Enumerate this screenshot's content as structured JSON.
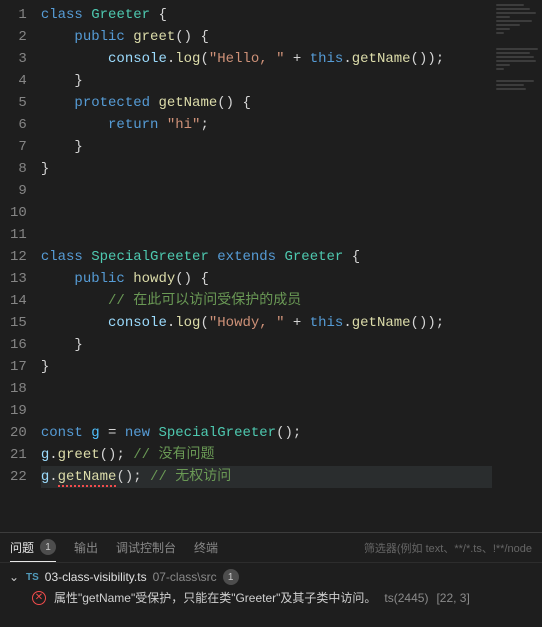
{
  "chart_data": null,
  "editor": {
    "lines": [
      {
        "n": 1,
        "seg": [
          [
            "tk-kw",
            "class "
          ],
          [
            "tk-cls",
            "Greeter"
          ],
          [
            "tk-pun",
            " {"
          ]
        ]
      },
      {
        "n": 2,
        "seg": [
          [
            "tk-pun",
            "    "
          ],
          [
            "tk-kw",
            "public "
          ],
          [
            "tk-fn",
            "greet"
          ],
          [
            "tk-pun",
            "() {"
          ]
        ]
      },
      {
        "n": 3,
        "seg": [
          [
            "tk-pun",
            "        "
          ],
          [
            "tk-var",
            "console"
          ],
          [
            "tk-pun",
            "."
          ],
          [
            "tk-fn",
            "log"
          ],
          [
            "tk-pun",
            "("
          ],
          [
            "tk-str",
            "\"Hello, \""
          ],
          [
            "tk-pun",
            " + "
          ],
          [
            "tk-kw",
            "this"
          ],
          [
            "tk-pun",
            "."
          ],
          [
            "tk-fn",
            "getName"
          ],
          [
            "tk-pun",
            "());"
          ]
        ]
      },
      {
        "n": 4,
        "seg": [
          [
            "tk-pun",
            "    }"
          ]
        ]
      },
      {
        "n": 5,
        "seg": [
          [
            "tk-pun",
            "    "
          ],
          [
            "tk-kw",
            "protected "
          ],
          [
            "tk-fn",
            "getName"
          ],
          [
            "tk-pun",
            "() {"
          ]
        ]
      },
      {
        "n": 6,
        "seg": [
          [
            "tk-pun",
            "        "
          ],
          [
            "tk-kw",
            "return "
          ],
          [
            "tk-str",
            "\"hi\""
          ],
          [
            "tk-pun",
            ";"
          ]
        ]
      },
      {
        "n": 7,
        "seg": [
          [
            "tk-pun",
            "    }"
          ]
        ]
      },
      {
        "n": 8,
        "seg": [
          [
            "tk-pun",
            "}"
          ]
        ]
      },
      {
        "n": 9,
        "seg": [
          [
            "tk-pun",
            ""
          ]
        ]
      },
      {
        "n": 10,
        "seg": [
          [
            "tk-pun",
            ""
          ]
        ]
      },
      {
        "n": 11,
        "seg": [
          [
            "tk-pun",
            ""
          ]
        ]
      },
      {
        "n": 12,
        "seg": [
          [
            "tk-kw",
            "class "
          ],
          [
            "tk-cls",
            "SpecialGreeter"
          ],
          [
            "tk-kw",
            " extends "
          ],
          [
            "tk-cls",
            "Greeter"
          ],
          [
            "tk-pun",
            " {"
          ]
        ]
      },
      {
        "n": 13,
        "seg": [
          [
            "tk-pun",
            "    "
          ],
          [
            "tk-kw",
            "public "
          ],
          [
            "tk-fn",
            "howdy"
          ],
          [
            "tk-pun",
            "() {"
          ]
        ]
      },
      {
        "n": 14,
        "seg": [
          [
            "tk-pun",
            "        "
          ],
          [
            "tk-com",
            "// 在此可以访问受保护的成员"
          ]
        ]
      },
      {
        "n": 15,
        "seg": [
          [
            "tk-pun",
            "        "
          ],
          [
            "tk-var",
            "console"
          ],
          [
            "tk-pun",
            "."
          ],
          [
            "tk-fn",
            "log"
          ],
          [
            "tk-pun",
            "("
          ],
          [
            "tk-str",
            "\"Howdy, \""
          ],
          [
            "tk-pun",
            " + "
          ],
          [
            "tk-kw",
            "this"
          ],
          [
            "tk-pun",
            "."
          ],
          [
            "tk-fn",
            "getName"
          ],
          [
            "tk-pun",
            "());"
          ]
        ]
      },
      {
        "n": 16,
        "seg": [
          [
            "tk-pun",
            "    }"
          ]
        ]
      },
      {
        "n": 17,
        "seg": [
          [
            "tk-pun",
            "}"
          ]
        ]
      },
      {
        "n": 18,
        "seg": [
          [
            "tk-pun",
            ""
          ]
        ]
      },
      {
        "n": 19,
        "seg": [
          [
            "tk-pun",
            ""
          ]
        ]
      },
      {
        "n": 20,
        "seg": [
          [
            "tk-kw",
            "const "
          ],
          [
            "tk-obj",
            "g"
          ],
          [
            "tk-pun",
            " = "
          ],
          [
            "tk-kw",
            "new "
          ],
          [
            "tk-cls",
            "SpecialGreeter"
          ],
          [
            "tk-pun",
            "();"
          ]
        ]
      },
      {
        "n": 21,
        "seg": [
          [
            "tk-var",
            "g"
          ],
          [
            "tk-pun",
            "."
          ],
          [
            "tk-fn",
            "greet"
          ],
          [
            "tk-pun",
            "(); "
          ],
          [
            "tk-com",
            "// 没有问题"
          ]
        ]
      },
      {
        "n": 22,
        "hl": true,
        "seg": [
          [
            "tk-var",
            "g"
          ],
          [
            "tk-pun",
            "."
          ],
          [
            "tk-fn err-underline",
            "getName"
          ],
          [
            "tk-pun",
            "(); "
          ],
          [
            "tk-com",
            "// 无权访问"
          ]
        ]
      }
    ]
  },
  "panel": {
    "tabs": {
      "problems": "问题",
      "problems_count": "1",
      "output": "输出",
      "debug": "调试控制台",
      "terminal": "终端"
    },
    "filter_placeholder": "筛选器(例如 text、**/*.ts、!**/node",
    "problem": {
      "ts_label": "TS",
      "filename": "03-class-visibility.ts",
      "filepath": "07-class\\src",
      "file_count": "1",
      "message": "属性\"getName\"受保护，只能在类\"Greeter\"及其子类中访问。",
      "code": "ts(2445)",
      "loc": "[22, 3]"
    }
  }
}
